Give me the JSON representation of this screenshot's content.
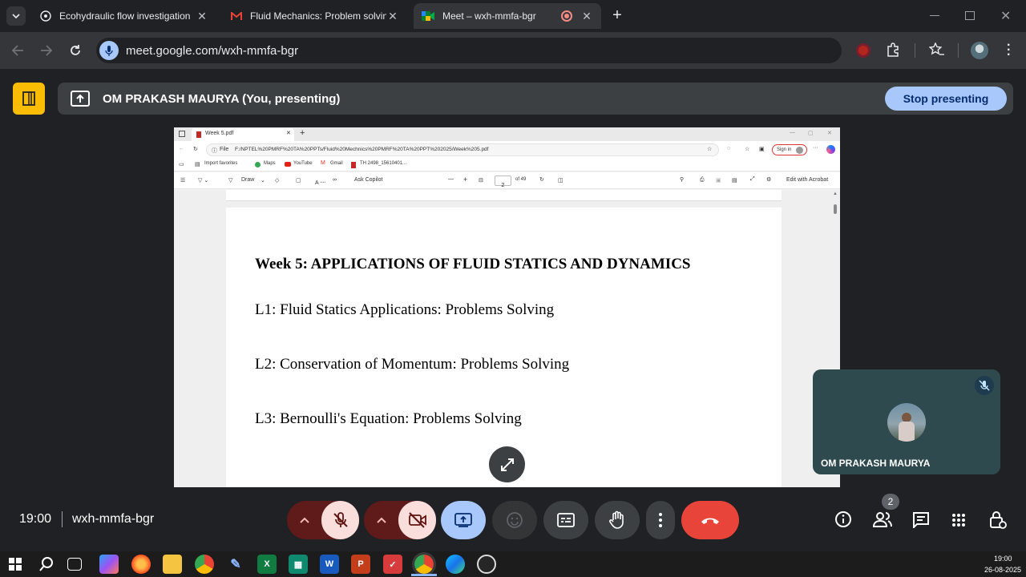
{
  "browser": {
    "tabs": [
      {
        "title": "Ecohydraulic flow investigation",
        "icon": "chatgpt-icon",
        "active": false
      },
      {
        "title": "Fluid Mechanics: Problem solving Ses",
        "icon": "gmail-icon",
        "active": false
      },
      {
        "title": "Meet – wxh-mmfa-bgr",
        "icon": "meet-icon",
        "active": true
      }
    ],
    "url": "meet.google.com/wxh-mmfa-bgr"
  },
  "meet": {
    "presenter_label": "OM PRAKASH MAURYA (You, presenting)",
    "stop_presenting": "Stop presenting",
    "time": "19:00",
    "meeting_code": "wxh-mmfa-bgr",
    "participant_name": "OM PRAKASH MAURYA",
    "participant_count": "2"
  },
  "shared_screen": {
    "tab_title": "Week 5.pdf",
    "file_label": "File",
    "path": "F:/NPTEL%20PMRF%20TA%20PPTs/Fluid%20Mechnics%20PMRF%20TA%20PPT%202025/Week%205.pdf",
    "sign_in": "Sign in",
    "bookmarks": [
      "Import favorites",
      "Maps",
      "YouTube",
      "Gmail",
      "TH 2498_15610401..."
    ],
    "pdf_toolbar": {
      "draw": "Draw",
      "ask_copilot": "Ask Copilot",
      "page": "2",
      "of_pages": "of 49",
      "edit_acrobat": "Edit with Acrobat"
    },
    "page": {
      "heading": "Week 5: APPLICATIONS OF FLUID STATICS AND DYNAMICS",
      "lines": [
        "L1: Fluid Statics Applications: Problems Solving",
        "L2: Conservation of Momentum: Problems Solving",
        "L3: Bernoulli's Equation: Problems Solving"
      ]
    }
  },
  "taskbar": {
    "time": "19:00",
    "date": "26-08-2025"
  },
  "colors": {
    "accent_blue": "#a8c7fa",
    "end_call_red": "#e9443a",
    "muted_bg": "#f9dedc"
  }
}
